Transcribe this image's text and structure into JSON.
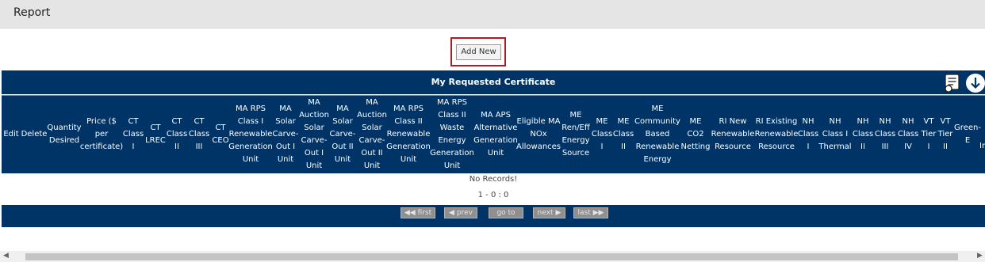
{
  "page": {
    "title": "Report"
  },
  "actions": {
    "add_new": "Add New"
  },
  "grid": {
    "caption": "My Requested Certificate",
    "columns": [
      "Edit",
      "Delete",
      "Quantity Desired",
      "Price ($ per certificate)",
      "CT Class I",
      "CT LREC",
      "CT Class II",
      "CT Class III",
      "CT CEO",
      "MA RPS Class I Renewable Generation Unit",
      "MA Solar Carve-Out I Unit",
      "MA Auction Solar Carve-Out I Unit",
      "MA Solar Carve-Out II Unit",
      "MA Auction Solar Carve-Out II Unit",
      "MA RPS Class II Renewable Generation Unit",
      "MA RPS Class II Waste Energy Generation Unit",
      "MA APS Alternative Generation Unit",
      "Eligible MA NOx Allowances",
      "ME Ren/Eff Energy Source",
      "ME Class I",
      "ME Class II",
      "ME Community Based Renewable Energy",
      "ME CO2 Netting",
      "RI New Renewable Resource",
      "RI Existing Renewable Resource",
      "NH Class I",
      "NH Class I Thermal",
      "NH Class II",
      "NH Class III",
      "NH Class IV",
      "VT Tier I",
      "VT Tier II",
      "Green-E",
      "In"
    ],
    "empty_message": "No Records!",
    "record_range": "1 - 0 : 0"
  },
  "pager": {
    "first": "first",
    "prev": "prev",
    "goto": "go to",
    "next": "next",
    "last": "last"
  },
  "icons": {
    "csv": "csv-export-icon",
    "download": "download-icon"
  },
  "colors": {
    "header_bg": "#003366",
    "highlight": "#b01c24"
  }
}
